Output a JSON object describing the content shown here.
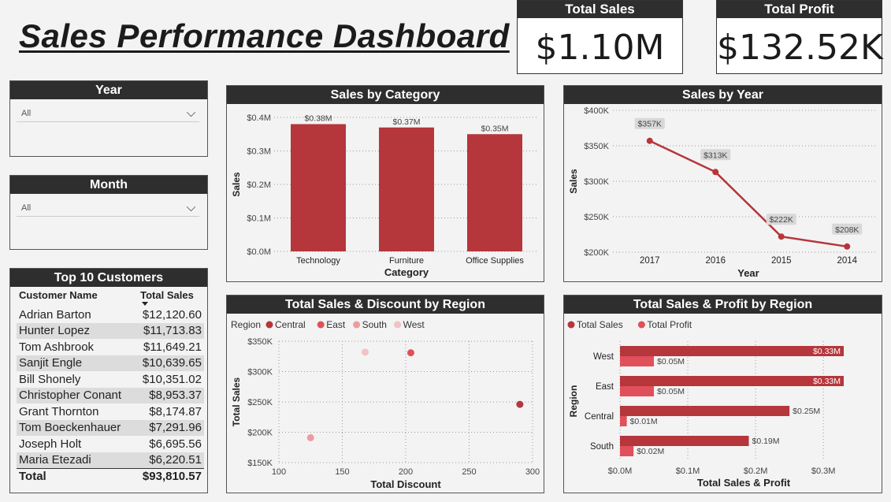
{
  "page": {
    "title": "Sales Performance Dashboard"
  },
  "kpis": {
    "total_sales": {
      "label": "Total Sales",
      "value": "$1.10M"
    },
    "total_profit": {
      "label": "Total Profit",
      "value": "$132.52K"
    }
  },
  "slicers": {
    "year": {
      "label": "Year",
      "value": "All"
    },
    "month": {
      "label": "Month",
      "value": "All"
    }
  },
  "customers": {
    "title": "Top 10 Customers",
    "headers": [
      "Customer Name",
      "Total Sales"
    ],
    "rows": [
      [
        "Adrian Barton",
        "$12,120.60"
      ],
      [
        "Hunter Lopez",
        "$11,713.83"
      ],
      [
        "Tom Ashbrook",
        "$11,649.21"
      ],
      [
        "Sanjit Engle",
        "$10,639.65"
      ],
      [
        "Bill Shonely",
        "$10,351.02"
      ],
      [
        "Christopher Conant",
        "$8,953.37"
      ],
      [
        "Grant Thornton",
        "$8,174.87"
      ],
      [
        "Tom Boeckenhauer",
        "$7,291.96"
      ],
      [
        "Joseph Holt",
        "$6,695.56"
      ],
      [
        "Maria Etezadi",
        "$6,220.51"
      ]
    ],
    "total_label": "Total",
    "total_value": "$93,810.57"
  },
  "colors": {
    "bar": "#b5363b",
    "east": "#e0505a",
    "south": "#ee9aa0",
    "west": "#f4c1c4",
    "header": "#2e2e2e"
  },
  "chart_data": [
    {
      "id": "sales_by_category",
      "type": "bar",
      "title": "Sales by Category",
      "xlabel": "Category",
      "ylabel": "Sales",
      "categories": [
        "Technology",
        "Furniture",
        "Office Supplies"
      ],
      "values": [
        0.38,
        0.37,
        0.35
      ],
      "labels": [
        "$0.38M",
        "$0.37M",
        "$0.35M"
      ],
      "yticks": [
        "$0.0M",
        "$0.1M",
        "$0.2M",
        "$0.3M",
        "$0.4M"
      ],
      "ylim": [
        0,
        0.4
      ]
    },
    {
      "id": "sales_by_year",
      "type": "line",
      "title": "Sales by Year",
      "xlabel": "Year",
      "ylabel": "Sales",
      "categories": [
        "2017",
        "2016",
        "2015",
        "2014"
      ],
      "values": [
        357,
        313,
        222,
        208
      ],
      "labels": [
        "$357K",
        "$313K",
        "$222K",
        "$208K"
      ],
      "yticks": [
        "$200K",
        "$250K",
        "$300K",
        "$350K",
        "$400K"
      ],
      "ylim": [
        200,
        400
      ]
    },
    {
      "id": "sales_discount_region",
      "type": "scatter",
      "title": "Total Sales & Discount by Region",
      "xlabel": "Total Discount",
      "ylabel": "Total Sales",
      "legend_title": "Region",
      "series": [
        {
          "name": "Central",
          "color": "#b5363b",
          "x": 290,
          "y": 246
        },
        {
          "name": "East",
          "color": "#e0505a",
          "x": 204,
          "y": 331
        },
        {
          "name": "South",
          "color": "#ee9aa0",
          "x": 125,
          "y": 191
        },
        {
          "name": "West",
          "color": "#f4c1c4",
          "x": 168,
          "y": 332
        }
      ],
      "xticks": [
        "100",
        "150",
        "200",
        "250",
        "300"
      ],
      "yticks": [
        "$150K",
        "$200K",
        "$250K",
        "$300K",
        "$350K"
      ],
      "xlim": [
        100,
        300
      ],
      "ylim": [
        150,
        350
      ]
    },
    {
      "id": "sales_profit_region",
      "type": "bar",
      "orientation": "horizontal",
      "title": "Total Sales & Profit by Region",
      "xlabel": "Total Sales & Profit",
      "ylabel": "Region",
      "categories": [
        "West",
        "East",
        "Central",
        "South"
      ],
      "series": [
        {
          "name": "Total Sales",
          "color": "#b5363b",
          "values": [
            0.33,
            0.33,
            0.25,
            0.19
          ],
          "labels": [
            "$0.33M",
            "$0.33M",
            "$0.25M",
            "$0.19M"
          ]
        },
        {
          "name": "Total Profit",
          "color": "#e0505a",
          "values": [
            0.05,
            0.05,
            0.01,
            0.02
          ],
          "labels": [
            "$0.05M",
            "$0.05M",
            "$0.01M",
            "$0.02M"
          ]
        }
      ],
      "xticks": [
        "$0.0M",
        "$0.1M",
        "$0.2M",
        "$0.3M"
      ],
      "xlim": [
        0,
        0.33
      ]
    }
  ]
}
